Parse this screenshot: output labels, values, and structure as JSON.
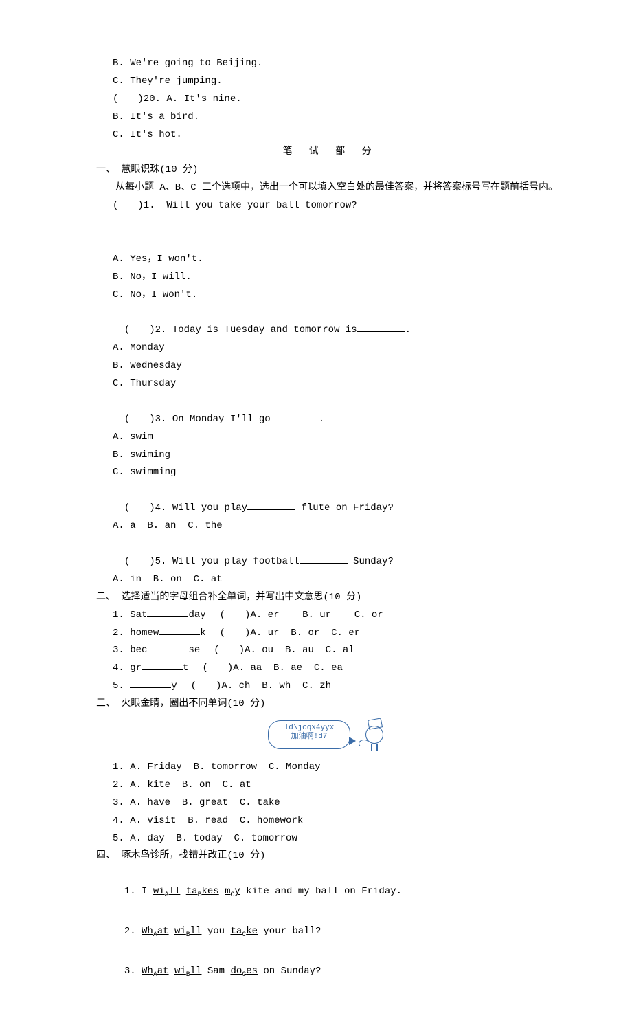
{
  "pre": {
    "l1": "B. We're going to Beijing.",
    "l2": "C. They're jumping.",
    "l3": "(　　)20. A. It's nine.",
    "l4": "B. It's a bird.",
    "l5": "C. It's hot."
  },
  "section_title": "笔 试 部 分",
  "s1": {
    "heading": "一、 慧眼识珠(10 分)",
    "intro": "从每小题 A、B、C 三个选项中，选出一个可以填入空白处的最佳答案，并将答案标号写在题前括号内。",
    "q1": {
      "stem": "(　　)1. —Will you take your ball tomorrow?",
      "dash": "—",
      "a": "A. Yes，I won't.",
      "b": "B. No，I will.",
      "c": "C. No，I won't."
    },
    "q2": {
      "stem_pre": "(　　)2. Today is Tuesday and tomorrow is",
      "stem_post": ".",
      "a": "A. Monday",
      "b": "B. Wednesday",
      "c": "C. Thursday"
    },
    "q3": {
      "stem_pre": "(　　)3. On Monday I'll go",
      "stem_post": ".",
      "a": "A. swim",
      "b": "B. swiming",
      "c": "C. swimming"
    },
    "q4": {
      "stem_pre": "(　　)4. Will you play",
      "stem_post": " flute on Friday?",
      "opts": "A. a  B. an  C. the"
    },
    "q5": {
      "stem_pre": "(　　)5. Will you play football",
      "stem_post": " Sunday?",
      "opts": "A. in  B. on  C. at"
    }
  },
  "s2": {
    "heading": "二、 选择适当的字母组合补全单词，并写出中文意思(10 分)",
    "rows": [
      {
        "idx": "1.",
        "pre": "Sat",
        "post": "day",
        "paren": "(　　)",
        "opts": "A. er    B. ur    C. or"
      },
      {
        "idx": "2.",
        "pre": "homew",
        "post": "k",
        "paren": "(　　)",
        "opts": "A. ur  B. or  C. er"
      },
      {
        "idx": "3.",
        "pre": "bec",
        "post": "se",
        "paren": "(　　)",
        "opts": "A. ou  B. au  C. al"
      },
      {
        "idx": "4.",
        "pre": "gr",
        "post": "t",
        "paren": "(　　)",
        "opts": "A. aa  B. ae  C. ea"
      },
      {
        "idx": "5.",
        "pre": "",
        "post": "y",
        "paren": "(　　)",
        "opts": "A. ch  B. wh  C. zh"
      }
    ]
  },
  "s3": {
    "heading": "三、 火眼金睛，圈出不同单词(10 分)",
    "sticker": {
      "line1": "ld\\jcqx4yyx",
      "line2": "加油啊!d7"
    },
    "rows": [
      {
        "idx": "1.",
        "opts": "A. Friday  B. tomorrow  C. Monday"
      },
      {
        "idx": "2.",
        "opts": "A. kite  B. on  C. at"
      },
      {
        "idx": "3.",
        "opts": "A. have  B. great  C. take"
      },
      {
        "idx": "4.",
        "opts": "A. visit  B. read  C. homework"
      },
      {
        "idx": "5.",
        "opts": "A. day  B. today  C. tomorrow"
      }
    ]
  },
  "s4": {
    "heading": "四、 啄木鸟诊所，找错并改正(10 分)",
    "q1": {
      "pre": "1. I ",
      "a": "wi",
      "as": "A",
      "a2": "ll",
      "sp": " ",
      "b": "ta",
      "bs": "B",
      "b2": "kes",
      "sp2": " ",
      "c": "m",
      "cs": "C",
      "c2": "y",
      "post": " kite and my ball on Friday."
    },
    "q2": {
      "pre": "2. ",
      "a": "Wh",
      "as": "A",
      "a2": "at",
      "sp": " ",
      "b": "wi",
      "bs": "B",
      "b2": "ll",
      "sp2": " you ",
      "c": "ta",
      "cs": "C",
      "c2": "ke",
      "post": " your ball? "
    },
    "q3": {
      "pre": "3. ",
      "a": "Wh",
      "as": "A",
      "a2": "at",
      "sp": " ",
      "b": "wi",
      "bs": "B",
      "b2": "ll",
      "sp2": " Sam ",
      "c": "do",
      "cs": "C",
      "c2": "es",
      "post": " on Sunday? "
    }
  }
}
